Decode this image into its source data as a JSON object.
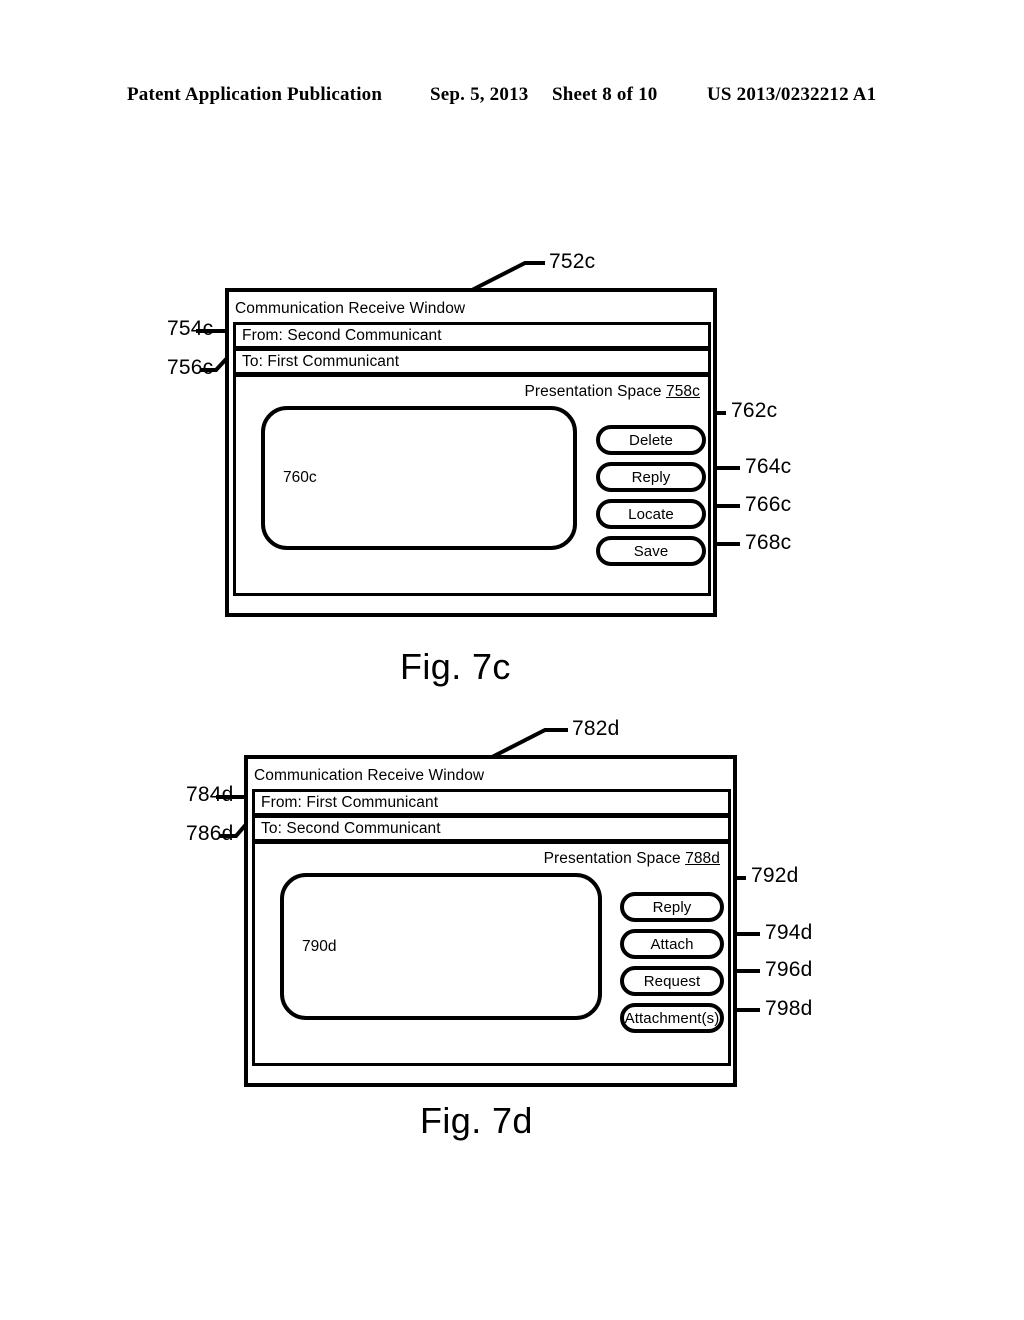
{
  "header": {
    "publication": "Patent Application Publication",
    "date": "Sep. 5, 2013",
    "sheet": "Sheet 8 of 10",
    "patent_number": "US 2013/0232212 A1"
  },
  "figures": [
    {
      "caption": "Fig. 7c",
      "window_ref": "752c",
      "window_title": "Communication Receive Window",
      "from_ref": "754c",
      "from_label": "From: Second Communicant",
      "to_ref": "756c",
      "to_label": "To: First Communicant",
      "presentation_space_label": "Presentation Space",
      "presentation_space_ref": "758c",
      "content_ref": "760c",
      "buttons": [
        {
          "label": "Delete",
          "ref": "762c"
        },
        {
          "label": "Reply",
          "ref": "764c"
        },
        {
          "label": "Locate",
          "ref": "766c"
        },
        {
          "label": "Save",
          "ref": "768c"
        }
      ]
    },
    {
      "caption": "Fig. 7d",
      "window_ref": "782d",
      "window_title": "Communication Receive Window",
      "from_ref": "784d",
      "from_label": "From: First Communicant",
      "to_ref": "786d",
      "to_label": "To: Second Communicant",
      "presentation_space_label": "Presentation Space",
      "presentation_space_ref": "788d",
      "content_ref": "790d",
      "buttons": [
        {
          "label": "Reply",
          "ref": "792d"
        },
        {
          "label": "Attach",
          "ref": "794d"
        },
        {
          "label": "Request",
          "ref": "796d"
        },
        {
          "label": "Attachment(s)",
          "ref": "798d"
        }
      ]
    }
  ],
  "colors": {
    "ink": "#000000",
    "paper": "#ffffff"
  }
}
